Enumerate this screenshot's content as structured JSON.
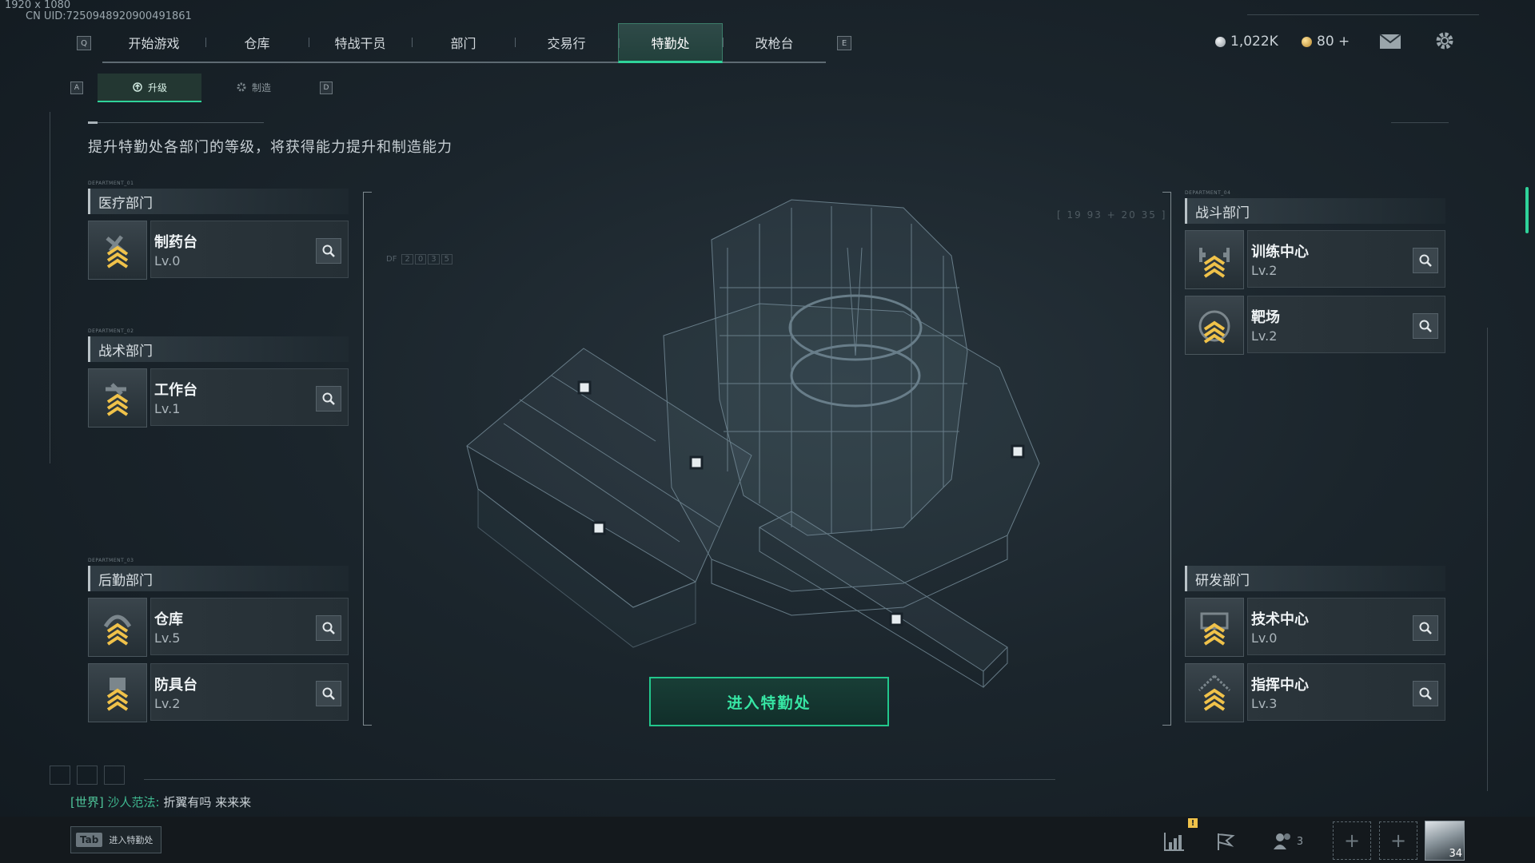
{
  "overlay": {
    "resolution": "1920 x 1080",
    "uid": "CN UID:7250948920900491861"
  },
  "nav": {
    "key_left": "Q",
    "key_right": "E",
    "tabs": [
      "开始游戏",
      "仓库",
      "特战干员",
      "部门",
      "交易行",
      "特勤处",
      "改枪台"
    ],
    "active_tab": "特勤处"
  },
  "currency": {
    "silver": "1,022K",
    "gold": "80 +"
  },
  "subnav": {
    "key_left": "A",
    "key_right": "D",
    "tabs": [
      "升级",
      "制造"
    ],
    "active_tab": "升级"
  },
  "description": "提升特勤处各部门的等级，将获得能力提升和制造能力",
  "departments_left": [
    {
      "tag": "DEPARTMENT_01",
      "name": "医疗部门",
      "facilities": [
        {
          "name": "制药台",
          "level": "Lv.0",
          "icon": "medical-chevron-icon"
        }
      ]
    },
    {
      "tag": "DEPARTMENT_02",
      "name": "战术部门",
      "facilities": [
        {
          "name": "工作台",
          "level": "Lv.1",
          "icon": "wrench-chevron-icon"
        }
      ]
    },
    {
      "tag": "DEPARTMENT_03",
      "name": "后勤部门",
      "facilities": [
        {
          "name": "仓库",
          "level": "Lv.5",
          "icon": "helmet-chevron-icon"
        },
        {
          "name": "防具台",
          "level": "Lv.2",
          "icon": "armor-chevron-icon"
        }
      ]
    }
  ],
  "departments_right": [
    {
      "tag": "DEPARTMENT_04",
      "name": "战斗部门",
      "facilities": [
        {
          "name": "训练中心",
          "level": "Lv.2",
          "icon": "training-chevron-icon"
        },
        {
          "name": "靶场",
          "level": "Lv.2",
          "icon": "target-chevron-icon"
        }
      ]
    },
    {
      "tag": "",
      "name": "研发部门",
      "facilities": [
        {
          "name": "技术中心",
          "level": "Lv.0",
          "icon": "tech-chevron-icon"
        },
        {
          "name": "指挥中心",
          "level": "Lv.3",
          "icon": "command-chevron-icon"
        }
      ]
    }
  ],
  "center": {
    "coord_label": "[ 19 93 + 20 35 ]",
    "df_label": "DF",
    "df_digits": [
      "2",
      "0",
      "3",
      "5"
    ],
    "enter_button": "进入特勤处"
  },
  "chat": {
    "channel": "[世界]",
    "sender": "沙人范法:",
    "message": "折翼有吗 来来来"
  },
  "bottom": {
    "tab_key": "Tab",
    "tab_hint": "进入特勤处",
    "squad_count": "3",
    "avatar_level": "34"
  },
  "colors": {
    "accent": "#2fd39a",
    "chevron": "#f0c24a",
    "bg": "#1b252c"
  }
}
